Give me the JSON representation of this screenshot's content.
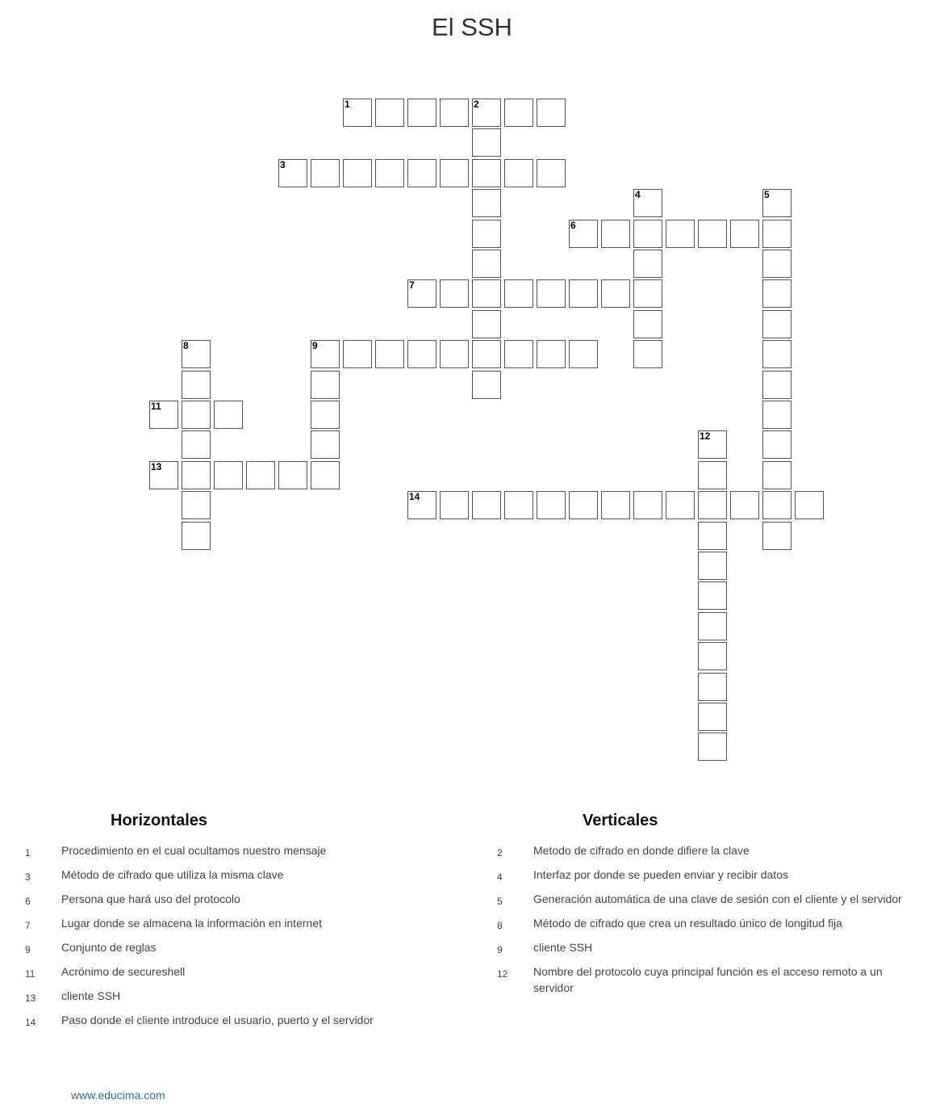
{
  "title": "El SSH",
  "grid": {
    "entries": [
      {
        "num": "1",
        "dir": "across",
        "row": 0,
        "col": 5,
        "len": 7
      },
      {
        "num": "2",
        "dir": "down",
        "row": 0,
        "col": 9,
        "len": 10
      },
      {
        "num": "3",
        "dir": "across",
        "row": 2,
        "col": 3,
        "len": 9
      },
      {
        "num": "4",
        "dir": "down",
        "row": 3,
        "col": 14,
        "len": 6
      },
      {
        "num": "5",
        "dir": "down",
        "row": 3,
        "col": 18,
        "len": 12
      },
      {
        "num": "6",
        "dir": "across",
        "row": 4,
        "col": 12,
        "len": 7
      },
      {
        "num": "7",
        "dir": "across",
        "row": 6,
        "col": 7,
        "len": 8
      },
      {
        "num": "8",
        "dir": "down",
        "row": 8,
        "col": 0,
        "len": 7
      },
      {
        "num": "9",
        "dir": "across",
        "row": 8,
        "col": 4,
        "len": 9
      },
      {
        "num": "9",
        "dir": "down",
        "row": 8,
        "col": 4,
        "len": 5
      },
      {
        "num": "11",
        "dir": "across",
        "row": 10,
        "col": -1,
        "len": 3
      },
      {
        "num": "12",
        "dir": "down",
        "row": 11,
        "col": 16,
        "len": 11
      },
      {
        "num": "13",
        "dir": "across",
        "row": 12,
        "col": -1,
        "len": 5
      },
      {
        "num": "14",
        "dir": "across",
        "row": 13,
        "col": 7,
        "len": 13
      }
    ]
  },
  "horizontales": {
    "heading": "Horizontales",
    "clues": [
      {
        "num": "1",
        "text": "Procedimiento en el cual ocultamos nuestro mensaje"
      },
      {
        "num": "3",
        "text": "Método de cifrado que utiliza la misma clave"
      },
      {
        "num": "6",
        "text": "Persona que hará uso del protocolo"
      },
      {
        "num": "7",
        "text": "Lugar donde se almacena la información en internet"
      },
      {
        "num": "9",
        "text": "Conjunto de reglas"
      },
      {
        "num": "11",
        "text": "Acrónimo de secureshell"
      },
      {
        "num": "13",
        "text": "cliente SSH"
      },
      {
        "num": "14",
        "text": "Paso donde el cliente introduce el usuario, puerto y el servidor"
      }
    ]
  },
  "verticales": {
    "heading": "Verticales",
    "clues": [
      {
        "num": "2",
        "text": "Metodo de cifrado en donde difiere la clave"
      },
      {
        "num": "4",
        "text": "Interfaz por donde se pueden enviar y recibir datos"
      },
      {
        "num": "5",
        "text": "Generación automática de una clave de sesión con el cliente y el servidor"
      },
      {
        "num": "8",
        "text": "Método de cifrado que crea un resultado único de longitud fija"
      },
      {
        "num": "9",
        "text": "cliente SSH"
      },
      {
        "num": "12",
        "text": "Nombre del protocolo cuya principal función es el acceso remoto a un servidor"
      }
    ]
  },
  "footer": {
    "link": "www.educima.com"
  },
  "colors": {
    "border": "#555555",
    "link": "#2a6bb5",
    "text": "#333333"
  }
}
